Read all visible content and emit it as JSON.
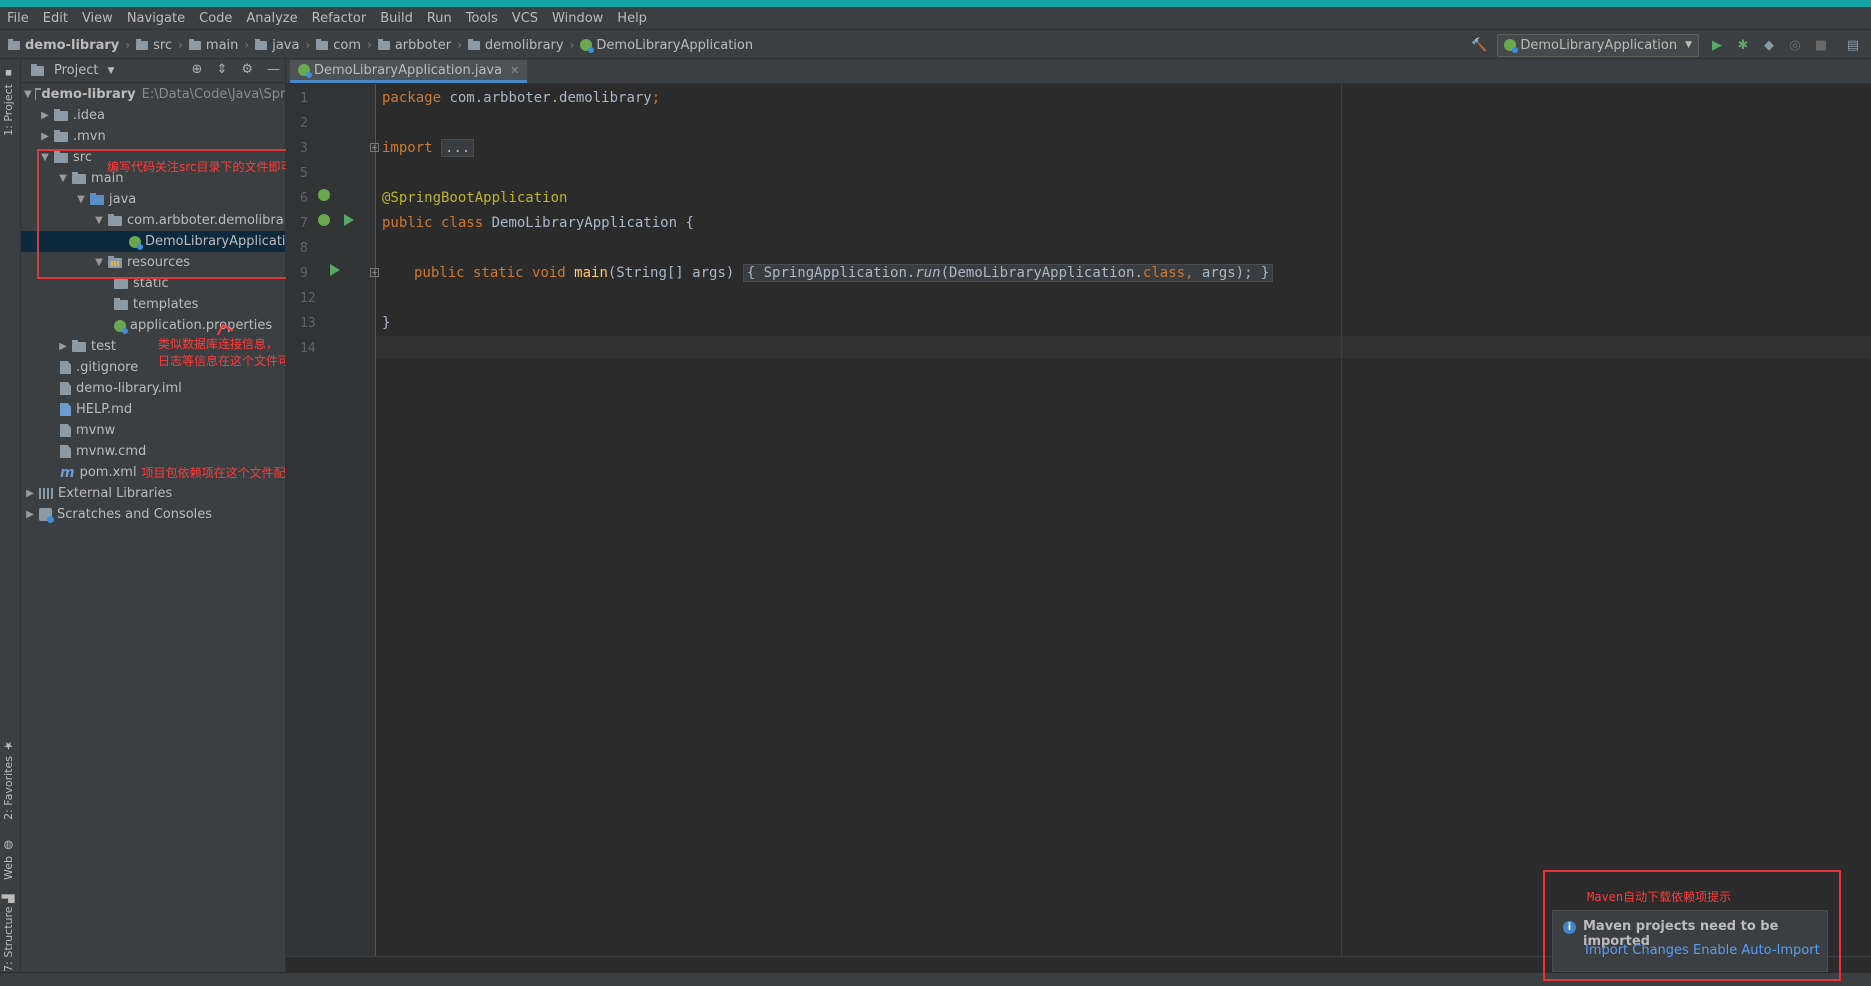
{
  "menu": [
    "File",
    "Edit",
    "View",
    "Navigate",
    "Code",
    "Analyze",
    "Refactor",
    "Build",
    "Run",
    "Tools",
    "VCS",
    "Window",
    "Help"
  ],
  "breadcrumbs": [
    "demo-library",
    "src",
    "main",
    "java",
    "com",
    "arbboter",
    "demolibrary",
    "DemoLibraryApplication"
  ],
  "run_config": {
    "label": "DemoLibraryApplication",
    "icon": "spring-boot-icon"
  },
  "left_stripe": {
    "project": "1: Project",
    "favorites": "2: Favorites",
    "web": "Web",
    "structure": "7: Structure"
  },
  "project_panel": {
    "title": "Project",
    "tree": [
      {
        "label": "demo-library",
        "path": "E:\\Data\\Code\\Java\\Spri"
      },
      {
        "label": ".idea"
      },
      {
        "label": ".mvn"
      },
      {
        "label": "src"
      },
      {
        "label": "main"
      },
      {
        "label": "java"
      },
      {
        "label": "com.arbboter.demolibrary"
      },
      {
        "label": "DemoLibraryApplicatio"
      },
      {
        "label": "resources"
      },
      {
        "label": "static"
      },
      {
        "label": "templates"
      },
      {
        "label": "application.properties"
      },
      {
        "label": "test"
      },
      {
        "label": ".gitignore"
      },
      {
        "label": "demo-library.iml"
      },
      {
        "label": "HELP.md"
      },
      {
        "label": "mvnw"
      },
      {
        "label": "mvnw.cmd"
      },
      {
        "label": "pom.xml",
        "note": "项目包依赖项在这个文件配置"
      },
      {
        "label": "External Libraries"
      },
      {
        "label": "Scratches and Consoles"
      }
    ]
  },
  "annotations": {
    "src_note": "编写代码关注src目录下的文件即可",
    "properties_note_1": "类似数据库连接信息，",
    "properties_note_2": "日志等信息在这个文件可以配置"
  },
  "editor": {
    "tab": "DemoLibraryApplication.java",
    "line_numbers": [
      "1",
      "2",
      "3",
      "5",
      "6",
      "7",
      "8",
      "9",
      "12",
      "13",
      "14"
    ],
    "code": {
      "l1_kw": "package",
      "l1_rest": " com.arbboter.demolibrary",
      "l1_semi": ";",
      "l3_kw": "import",
      "l3_fold": "...",
      "l6_ann": "@SpringBootApplication",
      "l7_kw": "public class",
      "l7_rest": " DemoLibraryApplication {",
      "l9_kw": "public static void",
      "l9_fn": "main",
      "l9_args": "(String[] args) ",
      "l9_fold_open": "{ SpringApplication.",
      "l9_run": "run",
      "l9_call": "(DemoLibraryApplication.",
      "l9_class": "class",
      "l9_comma": ",",
      "l9_tail": " args)",
      "l9_end": "; }",
      "l13": "}"
    }
  },
  "notification": {
    "annotation": "Maven自动下载依赖项提示",
    "message": "Maven projects need to be imported",
    "import_changes": "Import Changes",
    "enable_auto_import": "Enable Auto-Import"
  }
}
